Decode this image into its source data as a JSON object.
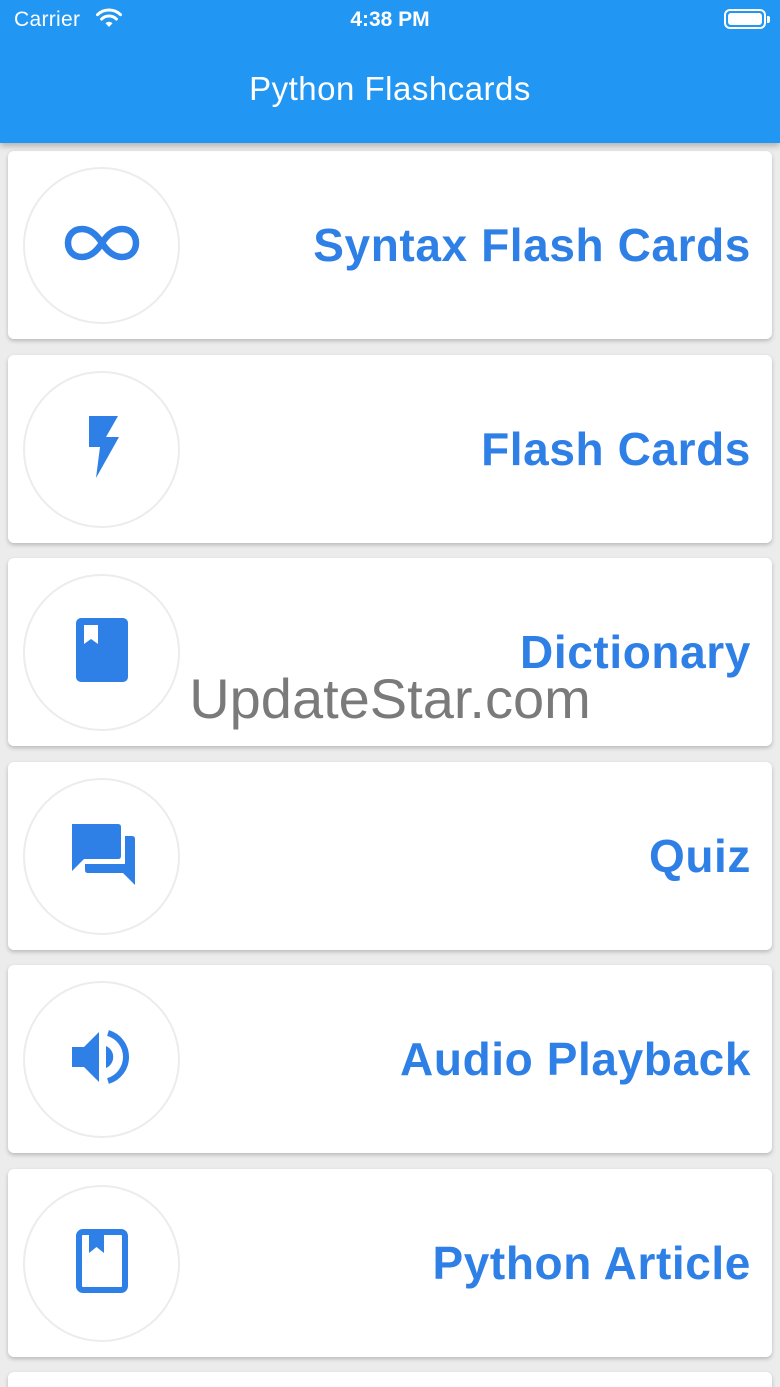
{
  "status_bar": {
    "carrier": "Carrier",
    "time": "4:38 PM"
  },
  "app_bar": {
    "title": "Python Flashcards",
    "color": "#2196f3"
  },
  "accent_color": "#2e7fe6",
  "menu_items": [
    {
      "label": "Syntax Flash Cards",
      "icon": "infinity-icon"
    },
    {
      "label": "Flash Cards",
      "icon": "lightning-bolt-icon"
    },
    {
      "label": "Dictionary",
      "icon": "book-icon"
    },
    {
      "label": "Quiz",
      "icon": "forum-chat-icon"
    },
    {
      "label": "Audio Playback",
      "icon": "volume-icon"
    },
    {
      "label": "Python Article",
      "icon": "bookmark-book-outline-icon"
    }
  ],
  "watermark": "UpdateStar.com"
}
